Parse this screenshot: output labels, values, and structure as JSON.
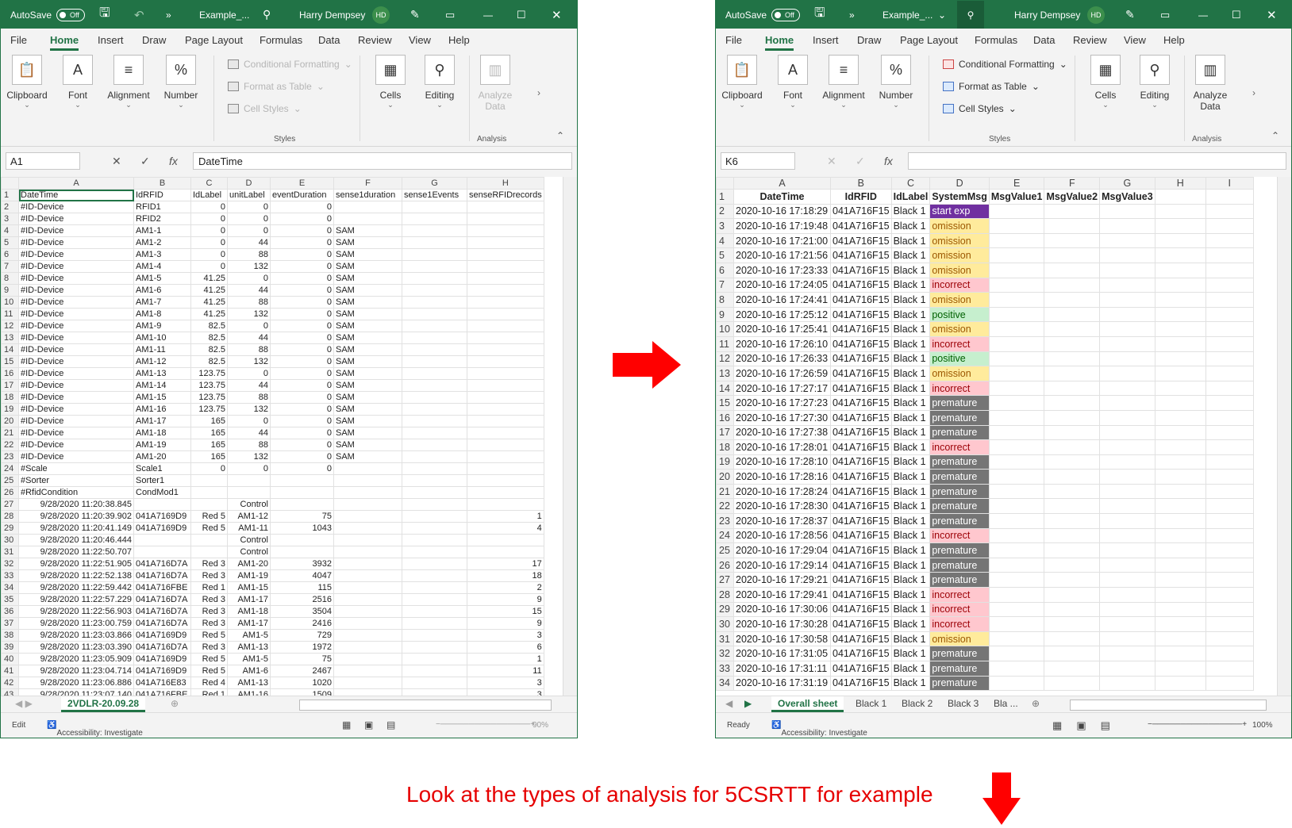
{
  "left_window": {
    "autosave": "AutoSave",
    "autosave_state": "Off",
    "filename": "Example_...",
    "user": "Harry Dempsey",
    "user_initials": "HD",
    "menu": [
      "File",
      "Home",
      "Insert",
      "Draw",
      "Page Layout",
      "Formulas",
      "Data",
      "Review",
      "View",
      "Help"
    ],
    "ribbon": {
      "clipboard": "Clipboard",
      "font": "Font",
      "alignment": "Alignment",
      "number": "Number",
      "conditional_formatting": "Conditional Formatting",
      "format_as_table": "Format as Table",
      "cell_styles": "Cell Styles",
      "styles": "Styles",
      "cells": "Cells",
      "editing": "Editing",
      "analyze_data_line1": "Analyze",
      "analyze_data_line2": "Data",
      "analysis": "Analysis"
    },
    "name_box": "A1",
    "formula_value": "DateTime",
    "columns": [
      "A",
      "B",
      "C",
      "D",
      "E",
      "F",
      "G",
      "H"
    ],
    "header_row": [
      "DateTime",
      "IdRFID",
      "IdLabel",
      "unitLabel",
      "eventDuration",
      "sense1duration",
      "sense1Events",
      "senseRFIDrecords"
    ],
    "rows": [
      [
        "#ID-Device",
        "RFID1",
        "0",
        "0",
        "0",
        "",
        "",
        ""
      ],
      [
        "#ID-Device",
        "RFID2",
        "0",
        "0",
        "0",
        "",
        "",
        ""
      ],
      [
        "#ID-Device",
        "AM1-1",
        "0",
        "0",
        "0",
        "SAM",
        "",
        ""
      ],
      [
        "#ID-Device",
        "AM1-2",
        "0",
        "44",
        "0",
        "SAM",
        "",
        ""
      ],
      [
        "#ID-Device",
        "AM1-3",
        "0",
        "88",
        "0",
        "SAM",
        "",
        ""
      ],
      [
        "#ID-Device",
        "AM1-4",
        "0",
        "132",
        "0",
        "SAM",
        "",
        ""
      ],
      [
        "#ID-Device",
        "AM1-5",
        "41.25",
        "0",
        "0",
        "SAM",
        "",
        ""
      ],
      [
        "#ID-Device",
        "AM1-6",
        "41.25",
        "44",
        "0",
        "SAM",
        "",
        ""
      ],
      [
        "#ID-Device",
        "AM1-7",
        "41.25",
        "88",
        "0",
        "SAM",
        "",
        ""
      ],
      [
        "#ID-Device",
        "AM1-8",
        "41.25",
        "132",
        "0",
        "SAM",
        "",
        ""
      ],
      [
        "#ID-Device",
        "AM1-9",
        "82.5",
        "0",
        "0",
        "SAM",
        "",
        ""
      ],
      [
        "#ID-Device",
        "AM1-10",
        "82.5",
        "44",
        "0",
        "SAM",
        "",
        ""
      ],
      [
        "#ID-Device",
        "AM1-11",
        "82.5",
        "88",
        "0",
        "SAM",
        "",
        ""
      ],
      [
        "#ID-Device",
        "AM1-12",
        "82.5",
        "132",
        "0",
        "SAM",
        "",
        ""
      ],
      [
        "#ID-Device",
        "AM1-13",
        "123.75",
        "0",
        "0",
        "SAM",
        "",
        ""
      ],
      [
        "#ID-Device",
        "AM1-14",
        "123.75",
        "44",
        "0",
        "SAM",
        "",
        ""
      ],
      [
        "#ID-Device",
        "AM1-15",
        "123.75",
        "88",
        "0",
        "SAM",
        "",
        ""
      ],
      [
        "#ID-Device",
        "AM1-16",
        "123.75",
        "132",
        "0",
        "SAM",
        "",
        ""
      ],
      [
        "#ID-Device",
        "AM1-17",
        "165",
        "0",
        "0",
        "SAM",
        "",
        ""
      ],
      [
        "#ID-Device",
        "AM1-18",
        "165",
        "44",
        "0",
        "SAM",
        "",
        ""
      ],
      [
        "#ID-Device",
        "AM1-19",
        "165",
        "88",
        "0",
        "SAM",
        "",
        ""
      ],
      [
        "#ID-Device",
        "AM1-20",
        "165",
        "132",
        "0",
        "SAM",
        "",
        ""
      ],
      [
        "#Scale",
        "Scale1",
        "0",
        "0",
        "0",
        "",
        "",
        ""
      ],
      [
        "#Sorter",
        "Sorter1",
        "",
        "",
        "",
        "",
        "",
        ""
      ],
      [
        "#RfidCondition",
        "CondMod1",
        "",
        "",
        "",
        "",
        "",
        ""
      ],
      [
        "9/28/2020 11:20:38.845",
        "",
        "",
        "Control",
        "",
        "",
        "",
        ""
      ],
      [
        "9/28/2020 11:20:39.902",
        "041A7169D9",
        "Red 5",
        "AM1-12",
        "75",
        "",
        "",
        "1"
      ],
      [
        "9/28/2020 11:20:41.149",
        "041A7169D9",
        "Red 5",
        "AM1-11",
        "1043",
        "",
        "",
        "4"
      ],
      [
        "9/28/2020 11:20:46.444",
        "",
        "",
        "Control",
        "",
        "",
        "",
        ""
      ],
      [
        "9/28/2020 11:22:50.707",
        "",
        "",
        "Control",
        "",
        "",
        "",
        ""
      ],
      [
        "9/28/2020 11:22:51.905",
        "041A716D7A",
        "Red 3",
        "AM1-20",
        "3932",
        "",
        "",
        "17"
      ],
      [
        "9/28/2020 11:22:52.138",
        "041A716D7A",
        "Red 3",
        "AM1-19",
        "4047",
        "",
        "",
        "18"
      ],
      [
        "9/28/2020 11:22:59.442",
        "041A716FBE",
        "Red 1",
        "AM1-15",
        "115",
        "",
        "",
        "2"
      ],
      [
        "9/28/2020 11:22:57.229",
        "041A716D7A",
        "Red 3",
        "AM1-17",
        "2516",
        "",
        "",
        "9"
      ],
      [
        "9/28/2020 11:22:56.903",
        "041A716D7A",
        "Red 3",
        "AM1-18",
        "3504",
        "",
        "",
        "15"
      ],
      [
        "9/28/2020 11:23:00.759",
        "041A716D7A",
        "Red 3",
        "AM1-17",
        "2416",
        "",
        "",
        "9"
      ],
      [
        "9/28/2020 11:23:03.866",
        "041A7169D9",
        "Red 5",
        "AM1-5",
        "729",
        "",
        "",
        "3"
      ],
      [
        "9/28/2020 11:23:03.390",
        "041A716D7A",
        "Red 3",
        "AM1-13",
        "1972",
        "",
        "",
        "6"
      ],
      [
        "9/28/2020 11:23:05.909",
        "041A7169D9",
        "Red 5",
        "AM1-5",
        "75",
        "",
        "",
        "1"
      ],
      [
        "9/28/2020 11:23:04.714",
        "041A7169D9",
        "Red 5",
        "AM1-6",
        "2467",
        "",
        "",
        "11"
      ],
      [
        "9/28/2020 11:23:06.886",
        "041A716E83",
        "Red 4",
        "AM1-13",
        "1020",
        "",
        "",
        "3"
      ],
      [
        "9/28/2020 11:23:07.140",
        "041A716FBE",
        "Red 1",
        "AM1-16",
        "1509",
        "",
        "",
        "3"
      ]
    ],
    "sheet_tab": "2VDLR-20.09.28",
    "status_mode": "Edit",
    "accessibility": "Accessibility: Investigate",
    "zoom": "90%"
  },
  "right_window": {
    "autosave": "AutoSave",
    "autosave_state": "Off",
    "filename": "Example_...",
    "user": "Harry Dempsey",
    "user_initials": "HD",
    "menu": [
      "File",
      "Home",
      "Insert",
      "Draw",
      "Page Layout",
      "Formulas",
      "Data",
      "Review",
      "View",
      "Help"
    ],
    "ribbon": {
      "clipboard": "Clipboard",
      "font": "Font",
      "alignment": "Alignment",
      "number": "Number",
      "conditional_formatting": "Conditional Formatting",
      "format_as_table": "Format as Table",
      "cell_styles": "Cell Styles",
      "styles": "Styles",
      "cells": "Cells",
      "editing": "Editing",
      "analyze_data_line1": "Analyze",
      "analyze_data_line2": "Data",
      "analysis": "Analysis"
    },
    "name_box": "K6",
    "formula_value": "",
    "columns": [
      "A",
      "B",
      "C",
      "D",
      "E",
      "F",
      "G",
      "H",
      "I"
    ],
    "header_row": [
      "DateTime",
      "IdRFID",
      "IdLabel",
      "SystemMsg",
      "MsgValue1",
      "MsgValue2",
      "MsgValue3",
      "",
      ""
    ],
    "rows": [
      [
        "2020-10-16 17:18:29",
        "041A716F15",
        "Black 1",
        "start exp"
      ],
      [
        "2020-10-16 17:19:48",
        "041A716F15",
        "Black 1",
        "omission"
      ],
      [
        "2020-10-16 17:21:00",
        "041A716F15",
        "Black 1",
        "omission"
      ],
      [
        "2020-10-16 17:21:56",
        "041A716F15",
        "Black 1",
        "omission"
      ],
      [
        "2020-10-16 17:23:33",
        "041A716F15",
        "Black 1",
        "omission"
      ],
      [
        "2020-10-16 17:24:05",
        "041A716F15",
        "Black 1",
        "incorrect"
      ],
      [
        "2020-10-16 17:24:41",
        "041A716F15",
        "Black 1",
        "omission"
      ],
      [
        "2020-10-16 17:25:12",
        "041A716F15",
        "Black 1",
        "positive"
      ],
      [
        "2020-10-16 17:25:41",
        "041A716F15",
        "Black 1",
        "omission"
      ],
      [
        "2020-10-16 17:26:10",
        "041A716F15",
        "Black 1",
        "incorrect"
      ],
      [
        "2020-10-16 17:26:33",
        "041A716F15",
        "Black 1",
        "positive"
      ],
      [
        "2020-10-16 17:26:59",
        "041A716F15",
        "Black 1",
        "omission"
      ],
      [
        "2020-10-16 17:27:17",
        "041A716F15",
        "Black 1",
        "incorrect"
      ],
      [
        "2020-10-16 17:27:23",
        "041A716F15",
        "Black 1",
        "premature"
      ],
      [
        "2020-10-16 17:27:30",
        "041A716F15",
        "Black 1",
        "premature"
      ],
      [
        "2020-10-16 17:27:38",
        "041A716F15",
        "Black 1",
        "premature"
      ],
      [
        "2020-10-16 17:28:01",
        "041A716F15",
        "Black 1",
        "incorrect"
      ],
      [
        "2020-10-16 17:28:10",
        "041A716F15",
        "Black 1",
        "premature"
      ],
      [
        "2020-10-16 17:28:16",
        "041A716F15",
        "Black 1",
        "premature"
      ],
      [
        "2020-10-16 17:28:24",
        "041A716F15",
        "Black 1",
        "premature"
      ],
      [
        "2020-10-16 17:28:30",
        "041A716F15",
        "Black 1",
        "premature"
      ],
      [
        "2020-10-16 17:28:37",
        "041A716F15",
        "Black 1",
        "premature"
      ],
      [
        "2020-10-16 17:28:56",
        "041A716F15",
        "Black 1",
        "incorrect"
      ],
      [
        "2020-10-16 17:29:04",
        "041A716F15",
        "Black 1",
        "premature"
      ],
      [
        "2020-10-16 17:29:14",
        "041A716F15",
        "Black 1",
        "premature"
      ],
      [
        "2020-10-16 17:29:21",
        "041A716F15",
        "Black 1",
        "premature"
      ],
      [
        "2020-10-16 17:29:41",
        "041A716F15",
        "Black 1",
        "incorrect"
      ],
      [
        "2020-10-16 17:30:06",
        "041A716F15",
        "Black 1",
        "incorrect"
      ],
      [
        "2020-10-16 17:30:28",
        "041A716F15",
        "Black 1",
        "incorrect"
      ],
      [
        "2020-10-16 17:30:58",
        "041A716F15",
        "Black 1",
        "omission"
      ],
      [
        "2020-10-16 17:31:05",
        "041A716F15",
        "Black 1",
        "premature"
      ],
      [
        "2020-10-16 17:31:11",
        "041A716F15",
        "Black 1",
        "premature"
      ],
      [
        "2020-10-16 17:31:19",
        "041A716F15",
        "Black 1",
        "premature"
      ]
    ],
    "sheet_tabs": [
      "Overall sheet",
      "Black 1",
      "Black 2",
      "Black 3",
      "Bla ..."
    ],
    "status_mode": "Ready",
    "accessibility": "Accessibility: Investigate",
    "zoom": "100%"
  },
  "caption": "Look at the types of analysis for 5CSRTT for example",
  "colors": {
    "excel_green": "#217346",
    "arrow_red": "#ff0000",
    "start_exp": "#7030a0",
    "omission": "#ffeb9c",
    "incorrect": "#ffc7ce",
    "positive": "#c6efce",
    "premature": "#757575"
  }
}
